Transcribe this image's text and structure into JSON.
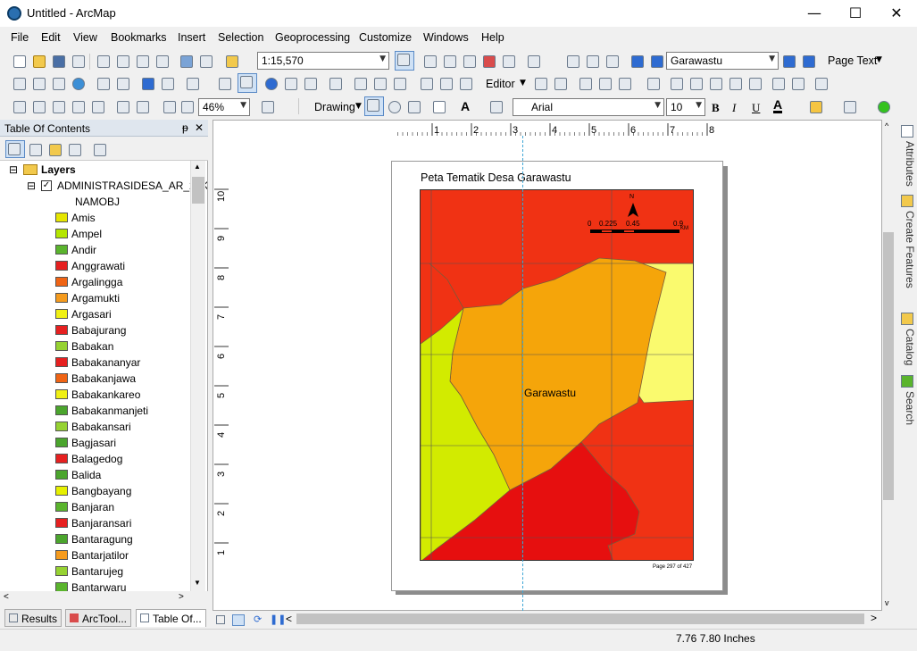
{
  "window": {
    "title": "Untitled - ArcMap",
    "minimize": "—",
    "maximize": "☐",
    "close": "✕"
  },
  "menu": [
    "File",
    "Edit",
    "View",
    "Bookmarks",
    "Insert",
    "Selection",
    "Geoprocessing",
    "Customize",
    "Windows",
    "Help"
  ],
  "toolbar": {
    "scale_value": "1:15,570",
    "page_text_selector": "Garawastu",
    "page_text_button": "Page Text",
    "editor_button": "Editor",
    "zoom_value": "46%",
    "drawing_button": "Drawing",
    "font_name": "Arial",
    "font_size": "10",
    "bold": "B",
    "italic": "I",
    "underline": "U"
  },
  "toc": {
    "title": "Table Of Contents",
    "pin": "ᵽ",
    "close": "✕",
    "layers_label": "Layers",
    "layer_name": "ADMINISTRASIDESA_AR_25K",
    "field_name": "NAMOBJ",
    "classes": [
      {
        "label": "Amis",
        "color": "#e6e600"
      },
      {
        "label": "Ampel",
        "color": "#b4e600"
      },
      {
        "label": "Andir",
        "color": "#5ab42d"
      },
      {
        "label": "Anggrawati",
        "color": "#e62020"
      },
      {
        "label": "Argalingga",
        "color": "#f06414"
      },
      {
        "label": "Argamukti",
        "color": "#f59b1e"
      },
      {
        "label": "Argasari",
        "color": "#f0f014"
      },
      {
        "label": "Babajurang",
        "color": "#e62020"
      },
      {
        "label": "Babakan",
        "color": "#96d232"
      },
      {
        "label": "Babakananyar",
        "color": "#e62020"
      },
      {
        "label": "Babakanjawa",
        "color": "#f06414"
      },
      {
        "label": "Babakankareo",
        "color": "#f0f014"
      },
      {
        "label": "Babakanmanjeti",
        "color": "#4ba52d"
      },
      {
        "label": "Babakansari",
        "color": "#96d232"
      },
      {
        "label": "Bagjasari",
        "color": "#4ba52d"
      },
      {
        "label": "Balagedog",
        "color": "#e62020"
      },
      {
        "label": "Balida",
        "color": "#4ba52d"
      },
      {
        "label": "Bangbayang",
        "color": "#e6f000"
      },
      {
        "label": "Banjaran",
        "color": "#5ab42d"
      },
      {
        "label": "Banjaransari",
        "color": "#e62020"
      },
      {
        "label": "Bantaragung",
        "color": "#4ba52d"
      },
      {
        "label": "Bantarjatilor",
        "color": "#f59b1e"
      },
      {
        "label": "Bantarujeg",
        "color": "#96d232"
      },
      {
        "label": "Bantarwaru",
        "color": "#5ab42d"
      }
    ]
  },
  "bottom_tabs": [
    "Results",
    "ArcTool...",
    "Table Of..."
  ],
  "right_tabs": [
    "Attributes",
    "Create Features",
    "Catalog",
    "Search"
  ],
  "ruler_top": [
    "1",
    "2",
    "3",
    "4",
    "5",
    "6",
    "7",
    "8"
  ],
  "ruler_left": [
    "10",
    "9",
    "8",
    "7",
    "6",
    "5",
    "4",
    "3",
    "2",
    "1"
  ],
  "map": {
    "title": "Peta Tematik Desa Garawastu",
    "village_label": "Garawastu",
    "page_label": "Page 297 of 427",
    "north": "N",
    "scale_labels": [
      "0",
      "0.225",
      "0.45",
      "0.9"
    ],
    "scale_unit": "KM",
    "colors": {
      "red": "#f03214",
      "orange": "#f5a50a",
      "yellow": "#fafa6e",
      "lime": "#d2eb00",
      "deep_red": "#e60f0f"
    }
  },
  "status": {
    "coordinates": "7.76  7.80 Inches"
  }
}
